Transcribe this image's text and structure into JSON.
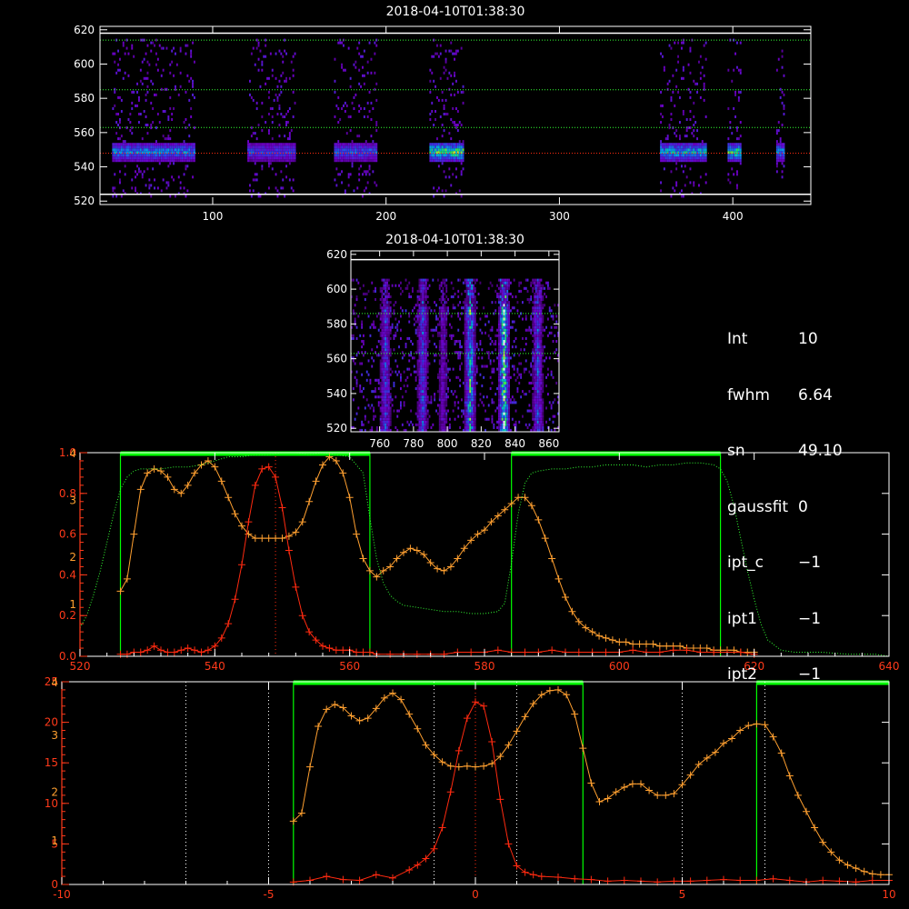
{
  "colors": {
    "background": "#000000",
    "axis": "#ffffff",
    "red_profile": "#ff2a10",
    "orange_profile": "#ffa030",
    "green_window": "#00ff00",
    "green_dotted": "#33ff33",
    "bottom_red_axis": "#ff3a1a"
  },
  "chart_data": [
    {
      "type": "heatmap",
      "title": "2018-04-10T01:38:30",
      "xlim": [
        35,
        445
      ],
      "ylim": [
        518,
        622
      ],
      "xticks": [
        100,
        200,
        300,
        400
      ],
      "yticks": [
        520,
        540,
        560,
        580,
        600,
        620
      ],
      "column_bands": [
        [
          42,
          90
        ],
        [
          120,
          148
        ],
        [
          170,
          195
        ],
        [
          225,
          245
        ],
        [
          358,
          385
        ],
        [
          397,
          405
        ],
        [
          425,
          430
        ]
      ],
      "band_intensity": [
        0.7,
        0.55,
        0.6,
        0.95,
        0.8,
        0.9,
        0.7
      ],
      "emission_center": 548,
      "hlines_green_dotted": [
        614,
        585,
        563
      ],
      "hline_red_dotted": 548,
      "hlines_white_solid": [
        618,
        524
      ]
    },
    {
      "type": "heatmap",
      "title": "2018-04-10T01:38:30",
      "xlim": [
        743,
        866
      ],
      "ylim": [
        518,
        622
      ],
      "xticks": [
        760,
        780,
        800,
        820,
        840,
        860
      ],
      "yticks": [
        520,
        540,
        560,
        580,
        600,
        620
      ],
      "streaks_x": [
        763,
        785,
        797,
        813,
        833,
        853
      ],
      "streak_intensity": [
        0.5,
        0.55,
        0.3,
        0.8,
        1.0,
        0.55
      ],
      "hlines_green_dotted": [
        586,
        563
      ],
      "hline_white_solid": 617
    },
    {
      "type": "line",
      "xlim": [
        520,
        640
      ],
      "xticks": [
        520,
        540,
        560,
        580,
        600,
        620,
        640
      ],
      "yticks_left": [
        "0.0",
        "0.2",
        "0.4",
        "0.6",
        "0.8",
        "1.0"
      ],
      "ytick_values_left": [
        0.0,
        0.2,
        0.4,
        0.6,
        0.8,
        1.0
      ],
      "yticks_overlay": [
        "1",
        "2",
        "3",
        "4"
      ],
      "ytick_values_overlay": [
        0.26,
        0.49,
        0.77,
        1.0
      ],
      "green_windows": [
        [
          526,
          563
        ],
        [
          584,
          615
        ]
      ],
      "red_vline": 549,
      "series": [
        {
          "color": "#ffa030",
          "x": [
            526,
            527,
            528,
            529,
            530,
            531,
            532,
            533,
            534,
            535,
            536,
            537,
            538,
            539,
            540,
            541,
            542,
            543,
            544,
            545,
            546,
            547,
            548,
            549,
            550,
            551,
            552,
            553,
            554,
            555,
            556,
            557,
            558,
            559,
            560,
            561,
            562,
            563,
            564,
            565,
            566,
            567,
            568,
            569,
            570,
            571,
            572,
            573,
            574,
            575,
            576,
            577,
            578,
            579,
            580,
            581,
            582,
            583,
            584,
            585,
            586,
            587,
            588,
            589,
            590,
            591,
            592,
            593,
            594,
            595,
            596,
            597,
            598,
            599,
            600,
            601,
            602,
            603,
            604,
            605,
            606,
            607,
            608,
            609,
            610,
            611,
            612,
            613,
            614,
            615,
            616,
            617,
            618,
            619,
            620
          ],
          "y": [
            0.32,
            0.38,
            0.6,
            0.82,
            0.9,
            0.92,
            0.91,
            0.88,
            0.82,
            0.8,
            0.84,
            0.9,
            0.94,
            0.96,
            0.93,
            0.86,
            0.78,
            0.7,
            0.64,
            0.6,
            0.58,
            0.58,
            0.58,
            0.58,
            0.58,
            0.59,
            0.61,
            0.66,
            0.76,
            0.86,
            0.94,
            0.98,
            0.96,
            0.9,
            0.78,
            0.6,
            0.48,
            0.42,
            0.39,
            0.42,
            0.44,
            0.48,
            0.51,
            0.53,
            0.52,
            0.5,
            0.46,
            0.43,
            0.42,
            0.44,
            0.48,
            0.53,
            0.57,
            0.6,
            0.62,
            0.66,
            0.69,
            0.72,
            0.75,
            0.78,
            0.78,
            0.74,
            0.67,
            0.58,
            0.48,
            0.38,
            0.29,
            0.22,
            0.17,
            0.14,
            0.12,
            0.1,
            0.09,
            0.08,
            0.07,
            0.07,
            0.06,
            0.06,
            0.06,
            0.06,
            0.05,
            0.05,
            0.05,
            0.05,
            0.04,
            0.04,
            0.04,
            0.04,
            0.03,
            0.03,
            0.03,
            0.03,
            0.02,
            0.02,
            0.02
          ]
        },
        {
          "color": "#ff2a10",
          "x": [
            526,
            527,
            528,
            529,
            530,
            531,
            532,
            533,
            534,
            535,
            536,
            537,
            538,
            539,
            540,
            541,
            542,
            543,
            544,
            545,
            546,
            547,
            548,
            549,
            550,
            551,
            552,
            553,
            554,
            555,
            556,
            557,
            558,
            559,
            560,
            561,
            562,
            563,
            564,
            566,
            568,
            570,
            572,
            574,
            576,
            578,
            580,
            582,
            584,
            586,
            588,
            590,
            592,
            594,
            596,
            598,
            600,
            602,
            604,
            606,
            608,
            610,
            612,
            614,
            616,
            618,
            620
          ],
          "y": [
            0.01,
            0.01,
            0.02,
            0.02,
            0.03,
            0.05,
            0.03,
            0.02,
            0.02,
            0.03,
            0.04,
            0.03,
            0.02,
            0.03,
            0.05,
            0.09,
            0.16,
            0.28,
            0.45,
            0.66,
            0.84,
            0.92,
            0.93,
            0.88,
            0.73,
            0.52,
            0.34,
            0.2,
            0.12,
            0.08,
            0.05,
            0.04,
            0.03,
            0.03,
            0.03,
            0.02,
            0.02,
            0.02,
            0.01,
            0.01,
            0.01,
            0.01,
            0.01,
            0.01,
            0.02,
            0.02,
            0.02,
            0.03,
            0.02,
            0.02,
            0.02,
            0.03,
            0.02,
            0.02,
            0.02,
            0.02,
            0.02,
            0.03,
            0.02,
            0.02,
            0.03,
            0.03,
            0.02,
            0.02,
            0.02,
            0.02,
            0.01
          ]
        },
        {
          "color": "#33ff33",
          "dotted": true,
          "x": [
            520,
            521,
            522,
            523,
            524,
            525,
            526,
            527,
            528,
            529,
            530,
            532,
            534,
            536,
            538,
            540,
            542,
            544,
            546,
            548,
            550,
            552,
            554,
            556,
            558,
            560,
            562,
            563,
            564,
            565,
            566,
            567,
            568,
            570,
            572,
            574,
            576,
            578,
            580,
            582,
            583,
            584,
            585,
            586,
            587,
            588,
            590,
            592,
            594,
            596,
            598,
            600,
            602,
            604,
            606,
            608,
            610,
            612,
            614,
            615,
            616,
            617,
            618,
            619,
            620,
            621,
            622,
            624,
            626,
            630,
            634,
            638,
            640
          ],
          "y": [
            0.14,
            0.2,
            0.3,
            0.42,
            0.56,
            0.7,
            0.82,
            0.88,
            0.91,
            0.92,
            0.92,
            0.92,
            0.93,
            0.93,
            0.94,
            0.96,
            0.98,
            0.98,
            0.99,
            0.99,
            1.0,
            1.0,
            0.99,
            1.0,
            0.99,
            0.98,
            0.9,
            0.68,
            0.48,
            0.36,
            0.3,
            0.27,
            0.25,
            0.24,
            0.23,
            0.22,
            0.22,
            0.21,
            0.21,
            0.22,
            0.26,
            0.46,
            0.7,
            0.85,
            0.9,
            0.91,
            0.92,
            0.92,
            0.93,
            0.93,
            0.94,
            0.94,
            0.94,
            0.93,
            0.94,
            0.94,
            0.95,
            0.95,
            0.94,
            0.92,
            0.86,
            0.74,
            0.58,
            0.42,
            0.28,
            0.16,
            0.08,
            0.03,
            0.02,
            0.02,
            0.01,
            0.01,
            0.0
          ]
        }
      ]
    },
    {
      "type": "line",
      "xlim": [
        -10,
        10
      ],
      "xticks": [
        -10,
        -5,
        0,
        5,
        10
      ],
      "yticks_left": [
        "0",
        "5",
        "10",
        "15",
        "20",
        "25"
      ],
      "ytick_values_left": [
        0,
        5,
        10,
        15,
        20,
        25
      ],
      "yticks_overlay": [
        "1",
        "2",
        "3",
        "4"
      ],
      "ytick_values_overlay": [
        5.5,
        11.5,
        18.5,
        25
      ],
      "green_windows": [
        [
          -4.4,
          2.6
        ],
        [
          6.8,
          10
        ]
      ],
      "white_vlines": [
        -7,
        -5,
        -1,
        1,
        5,
        7
      ],
      "red_vline": 0,
      "series": [
        {
          "color": "#ffa030",
          "x": [
            -4.4,
            -4.2,
            -4.0,
            -3.8,
            -3.6,
            -3.4,
            -3.2,
            -3.0,
            -2.8,
            -2.6,
            -2.4,
            -2.2,
            -2.0,
            -1.8,
            -1.6,
            -1.4,
            -1.2,
            -1.0,
            -0.8,
            -0.6,
            -0.4,
            -0.2,
            0.0,
            0.2,
            0.4,
            0.6,
            0.8,
            1.0,
            1.2,
            1.4,
            1.6,
            1.8,
            2.0,
            2.2,
            2.4,
            2.6,
            2.8,
            3.0,
            3.2,
            3.4,
            3.6,
            3.8,
            4.0,
            4.2,
            4.4,
            4.6,
            4.8,
            5.0,
            5.2,
            5.4,
            5.6,
            5.8,
            6.0,
            6.2,
            6.4,
            6.6,
            6.8,
            7.0,
            7.2,
            7.4,
            7.6,
            7.8,
            8.0,
            8.2,
            8.4,
            8.6,
            8.8,
            9.0,
            9.2,
            9.4,
            9.6,
            9.8,
            10.0
          ],
          "y": [
            7.8,
            8.8,
            14.5,
            19.5,
            21.6,
            22.2,
            21.8,
            20.8,
            20.2,
            20.5,
            21.7,
            23.0,
            23.6,
            22.8,
            21.0,
            19.2,
            17.2,
            16.0,
            15.1,
            14.6,
            14.5,
            14.6,
            14.5,
            14.6,
            14.9,
            15.8,
            17.2,
            18.9,
            20.7,
            22.3,
            23.4,
            23.9,
            24.0,
            23.4,
            21.0,
            16.8,
            12.5,
            10.2,
            10.6,
            11.4,
            12.0,
            12.4,
            12.4,
            11.6,
            11.0,
            11.0,
            11.2,
            12.3,
            13.5,
            14.8,
            15.6,
            16.3,
            17.4,
            18.0,
            19.0,
            19.6,
            19.8,
            19.7,
            18.2,
            16.2,
            13.4,
            11.0,
            9.0,
            7.0,
            5.2,
            4.0,
            3.0,
            2.4,
            2.0,
            1.6,
            1.3,
            1.2,
            1.2
          ]
        },
        {
          "color": "#ff2a10",
          "x": [
            -4.4,
            -4.0,
            -3.6,
            -3.2,
            -2.8,
            -2.4,
            -2.0,
            -1.6,
            -1.4,
            -1.2,
            -1.0,
            -0.8,
            -0.6,
            -0.4,
            -0.2,
            0.0,
            0.2,
            0.4,
            0.6,
            0.8,
            1.0,
            1.2,
            1.4,
            1.6,
            2.0,
            2.4,
            2.8,
            3.2,
            3.6,
            4.0,
            4.4,
            4.8,
            5.2,
            5.6,
            6.0,
            6.4,
            6.8,
            7.2,
            7.6,
            8.0,
            8.4,
            8.8,
            9.2,
            9.6,
            10.0
          ],
          "y": [
            0.3,
            0.5,
            1.0,
            0.6,
            0.5,
            1.2,
            0.8,
            1.8,
            2.4,
            3.2,
            4.4,
            7.0,
            11.4,
            16.5,
            20.5,
            22.5,
            22.0,
            17.6,
            10.5,
            5.0,
            2.3,
            1.5,
            1.2,
            1.0,
            0.9,
            0.7,
            0.6,
            0.4,
            0.5,
            0.4,
            0.3,
            0.4,
            0.4,
            0.5,
            0.6,
            0.5,
            0.5,
            0.7,
            0.5,
            0.3,
            0.5,
            0.4,
            0.3,
            0.5,
            0.5
          ]
        }
      ]
    }
  ],
  "info_panel": {
    "rows": [
      {
        "key": "Int",
        "value": "10"
      },
      {
        "key": "fwhm",
        "value": "6.64"
      },
      {
        "key": "sn",
        "value": "49.10"
      },
      {
        "key": "gaussfit",
        "value": "0"
      },
      {
        "key": "ipt_c",
        "value": "−1"
      },
      {
        "key": "ipt1",
        "value": "−1"
      },
      {
        "key": "ipt2",
        "value": "−1"
      }
    ]
  }
}
